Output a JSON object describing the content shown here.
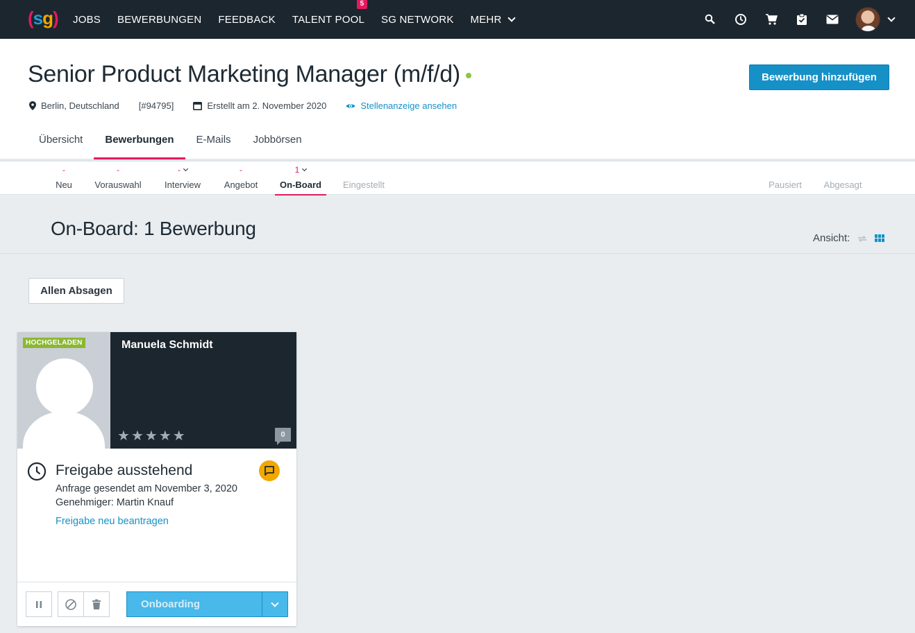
{
  "nav": {
    "links": [
      "JOBS",
      "BEWERBUNGEN",
      "FEEDBACK",
      "TALENT POOL",
      "SG NETWORK",
      "MEHR"
    ],
    "talent_pool_badge": "5"
  },
  "job": {
    "title": "Senior Product Marketing Manager (m/f/d)",
    "location": "Berlin, Deutschland",
    "id": "[#94795]",
    "created": "Erstellt am 2. November 2020",
    "view_ad": "Stellenanzeige ansehen",
    "add_button": "Bewerbung hinzufügen"
  },
  "tabs": [
    "Übersicht",
    "Bewerbungen",
    "E-Mails",
    "Jobbörsen"
  ],
  "stages": [
    {
      "count": "-",
      "label": "Neu"
    },
    {
      "count": "-",
      "label": "Vorauswahl"
    },
    {
      "count": "-",
      "label": "Interview"
    },
    {
      "count": "-",
      "label": "Angebot"
    },
    {
      "count": "1",
      "label": "On-Board"
    },
    {
      "count": "",
      "label": "Eingestellt"
    },
    {
      "count": "",
      "label": "Pausiert"
    },
    {
      "count": "",
      "label": "Abgesagt"
    }
  ],
  "section": {
    "title": "On-Board: 1 Bewerbung",
    "view_label": "Ansicht:",
    "reject_all": "Allen Absagen"
  },
  "card": {
    "badge": "HOCHGELADEN",
    "name": "Manuela Schmidt",
    "comments": "0",
    "approval_title": "Freigabe ausstehend",
    "approval_sent": "Anfrage gesendet am November 3, 2020",
    "approver": "Genehmiger: Martin Knauf",
    "reapply": "Freigabe neu beantragen",
    "action_button": "Onboarding"
  },
  "colors": {
    "accent": "#e5195e",
    "primary": "#1591c7",
    "nav_bg": "#1c262e"
  }
}
